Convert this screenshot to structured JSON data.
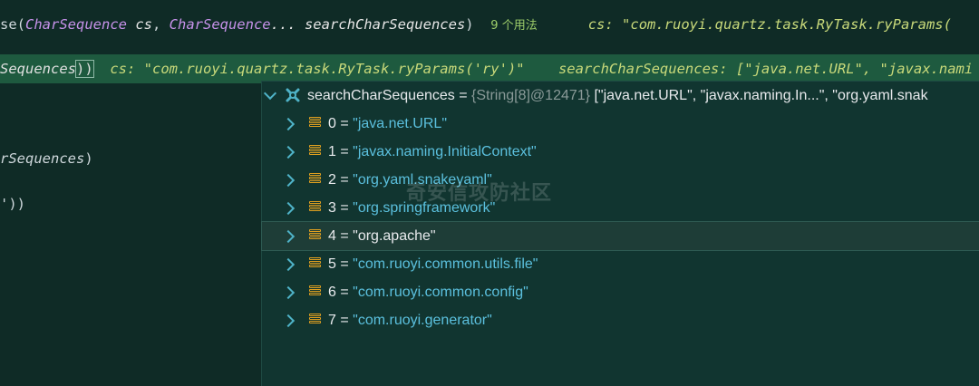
{
  "editor": {
    "line1": {
      "prefix": "se(",
      "type1": "CharSequence",
      "param1": " cs",
      "comma": ", ",
      "type2": "CharSequence",
      "param2": "... searchCharSequences",
      "close": ")",
      "usages": "9 个用法",
      "hint": "cs: \"com.ruoyi.quartz.task.RyTask.ryParams("
    },
    "line2": {
      "prefix": "Sequences",
      "close": "))",
      "hint1": "cs: \"com.ruoyi.quartz.task.RyTask.ryParams('ry')\"",
      "hint2": "searchCharSequences: [\"java.net.URL\", \"javax.nami"
    },
    "line3": {
      "text": "rSequences",
      "close": ")"
    },
    "line4": {
      "text": "'))"
    }
  },
  "variables": {
    "root": {
      "name": "searchCharSequences",
      "eq": " = ",
      "meta": "{String[8]@12471} ",
      "summary": "[\"java.net.URL\", \"javax.naming.In...\", \"org.yaml.snak"
    },
    "items": [
      {
        "index": "0",
        "value": "\"java.net.URL\""
      },
      {
        "index": "1",
        "value": "\"javax.naming.InitialContext\""
      },
      {
        "index": "2",
        "value": "\"org.yaml.snakeyaml\""
      },
      {
        "index": "3",
        "value": "\"org.springframework\""
      },
      {
        "index": "4",
        "value": "\"org.apache\""
      },
      {
        "index": "5",
        "value": "\"com.ruoyi.common.utils.file\""
      },
      {
        "index": "6",
        "value": "\"com.ruoyi.common.config\""
      },
      {
        "index": "7",
        "value": "\"com.ruoyi.generator\""
      }
    ],
    "selected_index": 4
  },
  "watermark": "奇安信攻防社区",
  "colors": {
    "editor_bg": "#0f2b26",
    "highlight_line": "#1e5a3f",
    "type_color": "#c792ea",
    "value_color": "#5bc0de",
    "field_icon": "#e0a020"
  }
}
